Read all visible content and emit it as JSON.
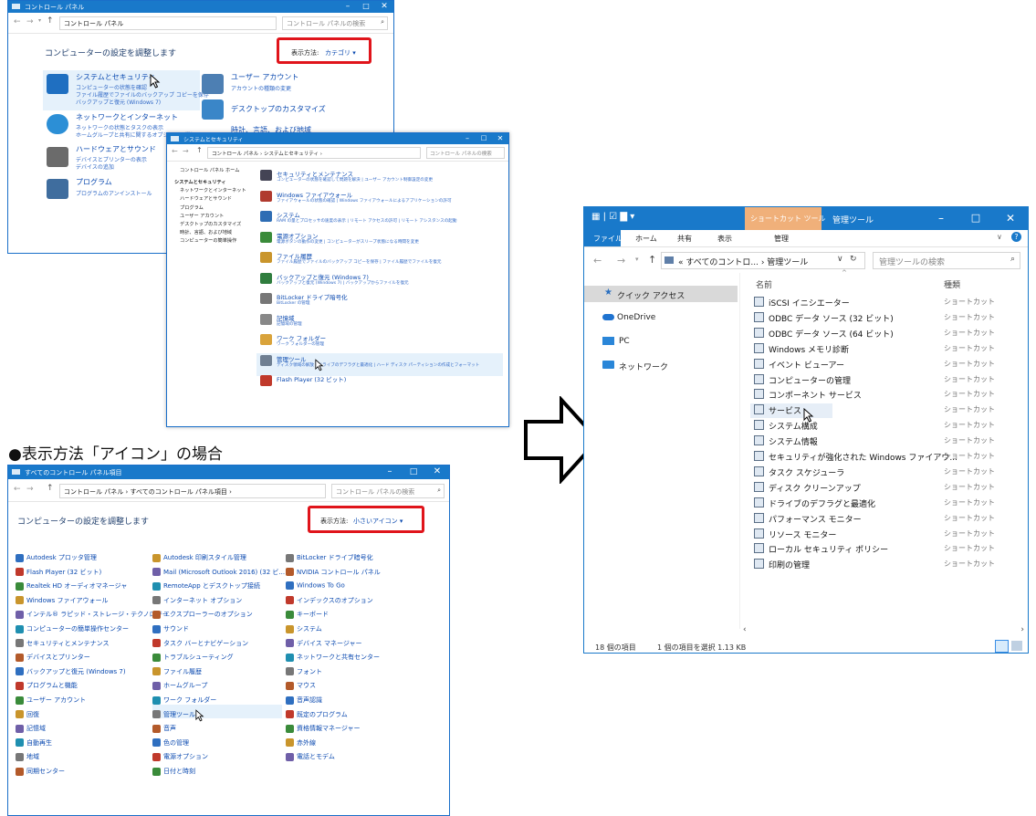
{
  "caption": "●表示方法「アイコン」の場合",
  "win1": {
    "title": "コントロール パネル",
    "address": "コントロール パネル",
    "search_placeholder": "コントロール パネルの検索",
    "heading": "コンピューターの設定を調整します",
    "view_label": "表示方法:",
    "view_value": "カテゴリ ▾",
    "categories": [
      {
        "title": "システムとセキュリティ",
        "links": [
          "コンピューターの状態を確認",
          "ファイル履歴でファイルのバックアップ コピーを保存",
          "バックアップと復元 (Windows 7)"
        ],
        "color": "#1f6fc1"
      },
      {
        "title": "ネットワークとインターネット",
        "links": [
          "ネットワークの状態とタスクの表示",
          "ホームグループと共有に関するオプションの選択"
        ],
        "color": "#2c8fd6"
      },
      {
        "title": "ハードウェアとサウンド",
        "links": [
          "デバイスとプリンターの表示",
          "デバイスの追加"
        ],
        "color": "#6b6b6b"
      },
      {
        "title": "プログラム",
        "links": [
          "プログラムのアンインストール"
        ],
        "color": "#3f6d9e"
      }
    ],
    "right_categories": [
      {
        "title": "ユーザー アカウント",
        "links": [
          "アカウントの種類の変更"
        ]
      },
      {
        "title": "デスクトップのカスタマイズ",
        "links": []
      },
      {
        "title": "時計、言語、および地域",
        "links": []
      }
    ]
  },
  "win2": {
    "title": "システムとセキュリティ",
    "address": "コントロール パネル › システムとセキュリティ ›",
    "search_placeholder": "コントロール パネルの検索",
    "sidebar": [
      "コントロール パネル ホーム",
      "システムとセキュリティ",
      "ネットワークとインターネット",
      "ハードウェアとサウンド",
      "プログラム",
      "ユーザー アカウント",
      "デスクトップのカスタマイズ",
      "時計、言語、および地域",
      "コンピューターの簡単操作"
    ],
    "items": [
      {
        "title": "セキュリティとメンテナンス",
        "desc": "コンピューターの状態を確認して問題を解決 | ユーザー アカウント制御設定の変更"
      },
      {
        "title": "Windows ファイアウォール",
        "desc": "ファイアウォールの状態の確認 | Windows ファイアウォールによるアプリケーションの許可"
      },
      {
        "title": "システム",
        "desc": "RAM の量とプロセッサの速度の表示 | リモート アクセスの許可 | リモート アシスタンスの起動"
      },
      {
        "title": "電源オプション",
        "desc": "電源ボタンの動作の変更 | コンピューターがスリープ状態になる時間を変更"
      },
      {
        "title": "ファイル履歴",
        "desc": "ファイル履歴でファイルのバックアップ コピーを保存 | ファイル履歴でファイルを復元"
      },
      {
        "title": "バックアップと復元 (Windows 7)",
        "desc": "バックアップと復元 (Windows 7) | バックアップからファイルを復元"
      },
      {
        "title": "BitLocker ドライブ暗号化",
        "desc": "BitLocker の管理"
      },
      {
        "title": "記憶域",
        "desc": "記憶域の管理"
      },
      {
        "title": "ワーク フォルダー",
        "desc": "ワーク フォルダーの管理"
      },
      {
        "title": "管理ツール",
        "desc": "ディスク領域の解放 | ドライブのデフラグと最適化 | ハード ディスク パーティションの作成とフォーマット"
      },
      {
        "title": "Flash Player (32 ビット)",
        "desc": ""
      }
    ]
  },
  "win3": {
    "title": "すべてのコントロール パネル項目",
    "address": "コントロール パネル › すべてのコントロール パネル項目 ›",
    "search_placeholder": "コントロール パネルの検索",
    "heading": "コンピューターの設定を調整します",
    "view_label": "表示方法:",
    "view_value": "小さいアイコン ▾",
    "col1": [
      "Autodesk プロッタ管理",
      "Flash Player (32 ビット)",
      "Realtek HD オーディオマネージャ",
      "Windows ファイアウォール",
      "インテル® ラピッド・ストレージ・テクノロジー",
      "コンピューターの簡単操作センター",
      "セキュリティとメンテナンス",
      "デバイスとプリンター",
      "バックアップと復元 (Windows 7)",
      "プログラムと機能",
      "ユーザー アカウント",
      "回復",
      "記憶域",
      "自動再生",
      "地域",
      "同期センター"
    ],
    "col2": [
      "Autodesk 印刷スタイル管理",
      "Mail (Microsoft Outlook 2016) (32 ビ...",
      "RemoteApp とデスクトップ接続",
      "インターネット オプション",
      "エクスプローラーのオプション",
      "サウンド",
      "タスク バーとナビゲーション",
      "トラブルシューティング",
      "ファイル履歴",
      "ホームグループ",
      "ワーク フォルダー",
      "管理ツール",
      "音声",
      "色の管理",
      "電源オプション",
      "日付と時刻"
    ],
    "col3": [
      "BitLocker ドライブ暗号化",
      "NVIDIA コントロール パネル",
      "Windows To Go",
      "インデックスのオプション",
      "キーボード",
      "システム",
      "デバイス マネージャー",
      "ネットワークと共有センター",
      "フォント",
      "マウス",
      "音声認識",
      "既定のプログラム",
      "資格情報マネージャー",
      "赤外線",
      "電話とモデム"
    ]
  },
  "win4": {
    "context_tab": "ショートカット ツール",
    "context_title": "管理ツール",
    "ribbon_tabs": [
      "ファイル",
      "ホーム",
      "共有",
      "表示",
      "管理"
    ],
    "address": "« すべてのコントロ... › 管理ツール",
    "search_placeholder": "管理ツールの検索",
    "nav": [
      "クイック アクセス",
      "OneDrive",
      "PC",
      "ネットワーク"
    ],
    "col_name": "名前",
    "col_type": "種類",
    "files": [
      {
        "name": "iSCSI イニシエーター",
        "type": "ショートカット"
      },
      {
        "name": "ODBC データ ソース (32 ビット)",
        "type": "ショートカット"
      },
      {
        "name": "ODBC データ ソース (64 ビット)",
        "type": "ショートカット"
      },
      {
        "name": "Windows メモリ診断",
        "type": "ショートカット"
      },
      {
        "name": "イベント ビューアー",
        "type": "ショートカット"
      },
      {
        "name": "コンピューターの管理",
        "type": "ショートカット"
      },
      {
        "name": "コンポーネント サービス",
        "type": "ショートカット"
      },
      {
        "name": "サービス",
        "type": "ショートカット"
      },
      {
        "name": "システム構成",
        "type": "ショートカット"
      },
      {
        "name": "システム情報",
        "type": "ショートカット"
      },
      {
        "name": "セキュリティが強化された Windows ファイアウ...",
        "type": "ショートカット"
      },
      {
        "name": "タスク スケジューラ",
        "type": "ショートカット"
      },
      {
        "name": "ディスク クリーンアップ",
        "type": "ショートカット"
      },
      {
        "name": "ドライブのデフラグと最適化",
        "type": "ショートカット"
      },
      {
        "name": "パフォーマンス モニター",
        "type": "ショートカット"
      },
      {
        "name": "リソース モニター",
        "type": "ショートカット"
      },
      {
        "name": "ローカル セキュリティ ポリシー",
        "type": "ショートカット"
      },
      {
        "name": "印刷の管理",
        "type": "ショートカット"
      }
    ],
    "status_count": "18 個の項目",
    "status_selected": "1 個の項目を選択  1.13 KB"
  },
  "colors": {
    "title_blue": "#1979ca",
    "highlight_red": "#e0141b",
    "context_orange": "#f0b07a"
  }
}
